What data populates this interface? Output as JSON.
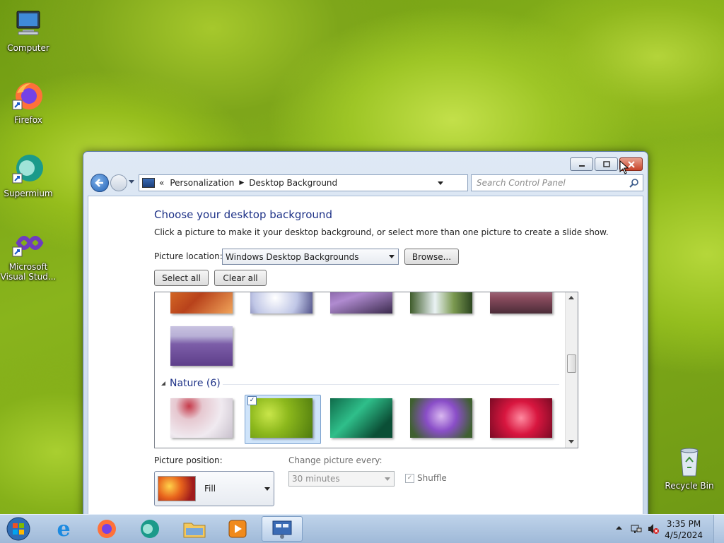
{
  "desktop": {
    "icons": [
      {
        "label": "Computer"
      },
      {
        "label": "Firefox"
      },
      {
        "label": "Supermium"
      },
      {
        "label": "Microsoft Visual Stud..."
      },
      {
        "label": "Recycle Bin"
      }
    ]
  },
  "window": {
    "breadcrumb": {
      "overflow": "«",
      "items": [
        "Personalization",
        "Desktop Background"
      ]
    },
    "search_placeholder": "Search Control Panel",
    "heading": "Choose your desktop background",
    "subtext": "Click a picture to make it your desktop background, or select more than one picture to create a slide show.",
    "picture_location": {
      "label": "Picture location:",
      "value": "Windows Desktop Backgrounds",
      "browse_label": "Browse..."
    },
    "select_all_label": "Select all",
    "clear_all_label": "Clear all",
    "groups": [
      {
        "title": "",
        "images": [
          "canyon",
          "ice-rocks",
          "river-falls",
          "waterfall",
          "cliff-dusk",
          "lavender-field"
        ]
      },
      {
        "title": "Nature (6)",
        "images": [
          "white-flower",
          "green-succulent",
          "green-leaves",
          "purple-thistle",
          "red-dahlia"
        ],
        "selected_index": 1
      }
    ],
    "picture_position": {
      "label": "Picture position:",
      "value": "Fill"
    },
    "change_picture": {
      "label": "Change picture every:",
      "value": "30 minutes"
    },
    "shuffle": {
      "label": "Shuffle",
      "checked": true
    }
  },
  "taskbar": {
    "apps": [
      "start",
      "internet-explorer",
      "firefox",
      "supermium",
      "file-explorer",
      "media-player",
      "control-panel"
    ],
    "active_app": "control-panel",
    "time": "3:35 PM",
    "date": "4/5/2024"
  }
}
